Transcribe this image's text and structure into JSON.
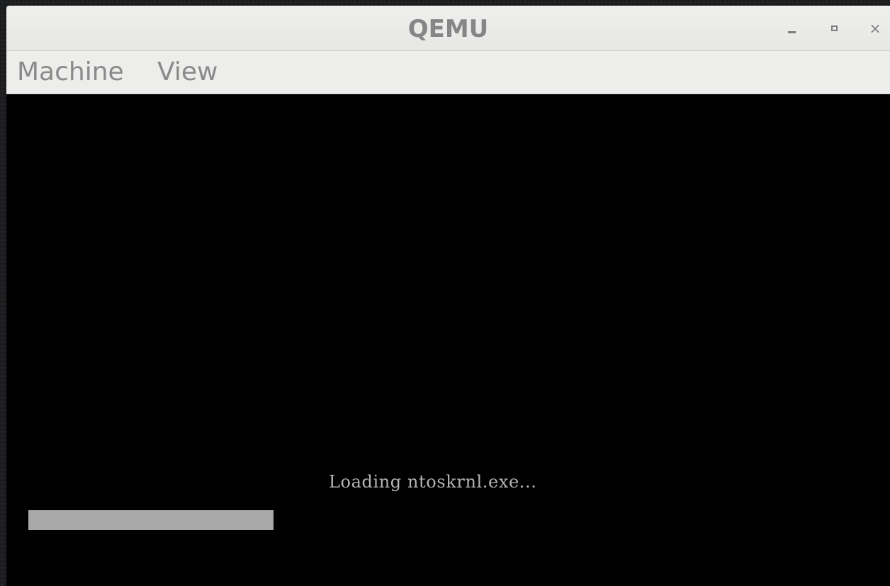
{
  "window": {
    "title": "QEMU",
    "controls": {
      "minimize_icon": "minimize-icon",
      "maximize_icon": "maximize-icon",
      "close_icon": "close-icon",
      "close_glyph": "×"
    }
  },
  "menubar": {
    "items": [
      {
        "label": "Machine"
      },
      {
        "label": "View"
      }
    ]
  },
  "screen": {
    "loading_text": "Loading ntoskrnl.exe...",
    "progress_fraction": 0.292
  },
  "colors": {
    "titlebar_bg": "#efefed",
    "menubar_bg": "#ededeb",
    "title_text": "#868686",
    "screen_bg": "#000000",
    "console_text": "#b4b4b4",
    "progress_fill": "#a8a8a8"
  }
}
